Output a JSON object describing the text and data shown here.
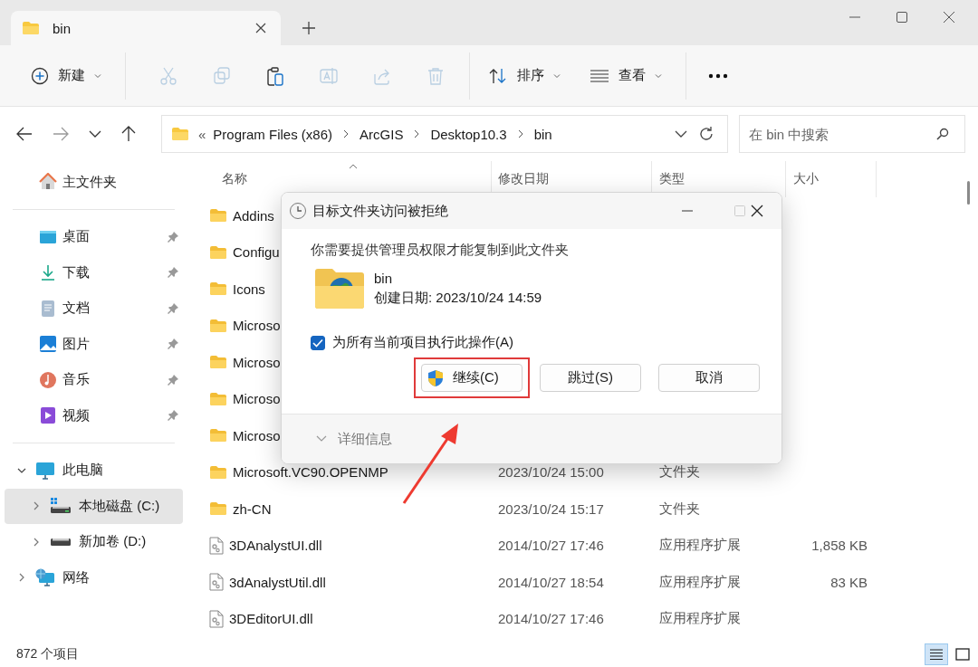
{
  "tab": {
    "title": "bin"
  },
  "toolbar": {
    "new_label": "新建",
    "actions": [
      {
        "kind": "cut",
        "disabled": true
      },
      {
        "kind": "copy",
        "disabled": true
      },
      {
        "kind": "paste",
        "disabled": false
      },
      {
        "kind": "rename",
        "disabled": true
      },
      {
        "kind": "share",
        "disabled": true
      },
      {
        "kind": "delete",
        "disabled": true
      }
    ],
    "sort_label": "排序",
    "view_label": "查看"
  },
  "address": {
    "overflow": "«",
    "segments": [
      "Program Files (x86)",
      "ArcGIS",
      "Desktop10.3",
      "bin"
    ]
  },
  "search": {
    "placeholder": "在 bin 中搜索"
  },
  "sidebar": {
    "home": "主文件夹",
    "quick_access": [
      {
        "label": "桌面",
        "kind": "desktop",
        "pinned": true
      },
      {
        "label": "下载",
        "kind": "download",
        "pinned": true
      },
      {
        "label": "文档",
        "kind": "document",
        "pinned": true
      },
      {
        "label": "图片",
        "kind": "picture",
        "pinned": true
      },
      {
        "label": "音乐",
        "kind": "music",
        "pinned": true
      },
      {
        "label": "视频",
        "kind": "video",
        "pinned": true
      }
    ],
    "tree": [
      {
        "label": "此电脑",
        "kind": "pc",
        "expanded": true,
        "selected": false,
        "children": [
          {
            "label": "本地磁盘 (C:)",
            "kind": "systemdrive",
            "expanded": false,
            "selected": true
          },
          {
            "label": "新加卷 (D:)",
            "kind": "drive",
            "expanded": false,
            "selected": false
          }
        ]
      },
      {
        "label": "网络",
        "kind": "network",
        "expanded": false,
        "selected": false
      }
    ]
  },
  "table": {
    "columns": [
      "名称",
      "修改日期",
      "类型",
      "大小"
    ],
    "rows": [
      {
        "name": "Addins",
        "kind": "folder"
      },
      {
        "name": "Configu",
        "kind": "folder"
      },
      {
        "name": "Icons",
        "kind": "folder"
      },
      {
        "name": "Microso",
        "kind": "folder"
      },
      {
        "name": "Microso",
        "kind": "folder"
      },
      {
        "name": "Microso",
        "kind": "folder"
      },
      {
        "name": "Microso",
        "kind": "folder"
      },
      {
        "name": "Microsoft.VC90.OPENMP",
        "kind": "folder",
        "date": "2023/10/24 15:00",
        "type": "文件夹"
      },
      {
        "name": "zh-CN",
        "kind": "folder",
        "date": "2023/10/24 15:17",
        "type": "文件夹"
      },
      {
        "name": "3DAnalystUI.dll",
        "kind": "dll",
        "date": "2014/10/27 17:46",
        "type": "应用程序扩展",
        "size": "1,858 KB"
      },
      {
        "name": "3dAnalystUtil.dll",
        "kind": "dll",
        "date": "2014/10/27 18:54",
        "type": "应用程序扩展",
        "size": "83 KB"
      },
      {
        "name": "3DEditorUI.dll",
        "kind": "dll",
        "date": "2014/10/27 17:46",
        "type": "应用程序扩展"
      }
    ]
  },
  "status_bar": {
    "count": "872 个项目",
    "views": [
      {
        "kind": "details",
        "selected": true
      },
      {
        "kind": "tiles",
        "selected": false
      }
    ]
  },
  "dialog": {
    "title": "目标文件夹访问被拒绝",
    "message": "你需要提供管理员权限才能复制到此文件夹",
    "item": {
      "name": "bin",
      "created": "创建日期: 2023/10/24 14:59"
    },
    "apply_all": {
      "label": "为所有当前项目执行此操作(A)",
      "checked": true
    },
    "buttons": [
      {
        "label": "继续(C)",
        "kind": "shield",
        "highlighted": true
      },
      {
        "label": "跳过(S)",
        "kind": "plain",
        "highlighted": false
      },
      {
        "label": "取消",
        "kind": "plain",
        "highlighted": false
      }
    ],
    "details": "详细信息"
  }
}
